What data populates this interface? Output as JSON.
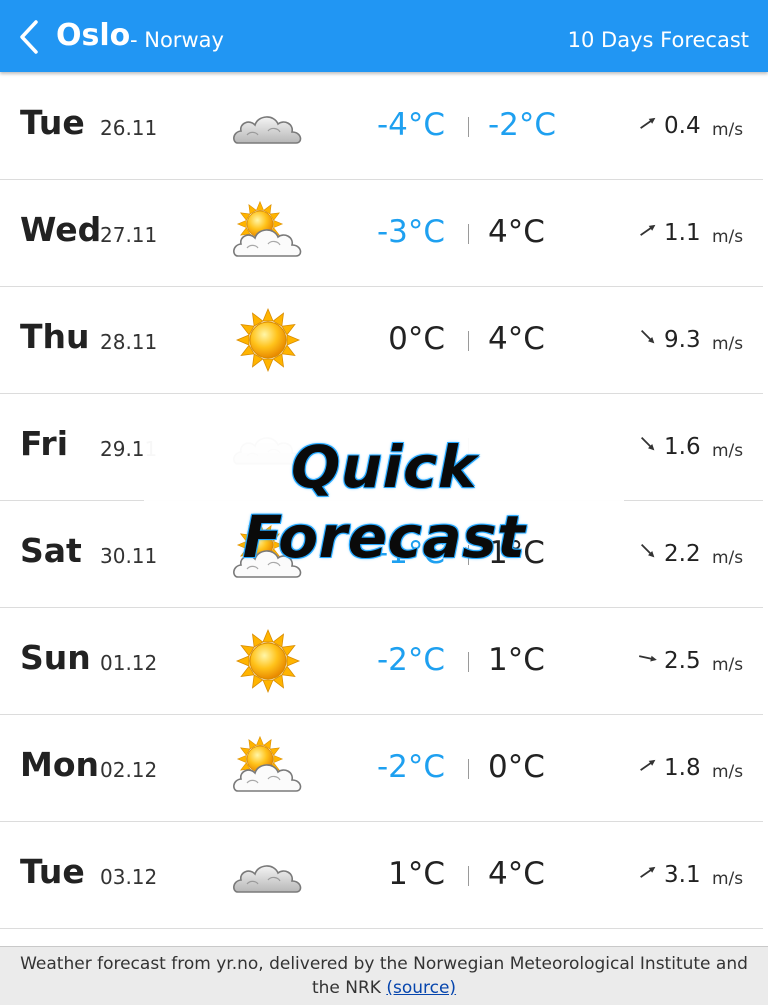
{
  "header": {
    "city": "Oslo",
    "country": "- Norway",
    "forecast_link": "10 Days Forecast"
  },
  "forecast": [
    {
      "day": "Tue",
      "date": "26.11",
      "icon": "cloud-icon",
      "min": "-4°C",
      "max": "-2°C",
      "min_neg": true,
      "max_neg": true,
      "wind_speed": "0.4",
      "wind_unit": "m/s",
      "wind_dir": "northeast"
    },
    {
      "day": "Wed",
      "date": "27.11",
      "icon": "partly-sunny-icon",
      "min": "-3°C",
      "max": "4°C",
      "min_neg": true,
      "max_neg": false,
      "wind_speed": "1.1",
      "wind_unit": "m/s",
      "wind_dir": "northeast"
    },
    {
      "day": "Thu",
      "date": "28.11",
      "icon": "sun-icon",
      "min": "0°C",
      "max": "4°C",
      "min_neg": false,
      "max_neg": false,
      "wind_speed": "9.3",
      "wind_unit": "m/s",
      "wind_dir": "southeast"
    },
    {
      "day": "Fri",
      "date": "29.11",
      "icon": "cloud-icon",
      "min": "",
      "max": "",
      "min_neg": false,
      "max_neg": false,
      "wind_speed": "1.6",
      "wind_unit": "m/s",
      "wind_dir": "southeast"
    },
    {
      "day": "Sat",
      "date": "30.11",
      "icon": "partly-sunny-icon",
      "min": "-1°C",
      "max": "1°C",
      "min_neg": true,
      "max_neg": false,
      "wind_speed": "2.2",
      "wind_unit": "m/s",
      "wind_dir": "southeast"
    },
    {
      "day": "Sun",
      "date": "01.12",
      "icon": "sun-icon",
      "min": "-2°C",
      "max": "1°C",
      "min_neg": true,
      "max_neg": false,
      "wind_speed": "2.5",
      "wind_unit": "m/s",
      "wind_dir": "east"
    },
    {
      "day": "Mon",
      "date": "02.12",
      "icon": "partly-sunny-icon",
      "min": "-2°C",
      "max": "0°C",
      "min_neg": true,
      "max_neg": false,
      "wind_speed": "1.8",
      "wind_unit": "m/s",
      "wind_dir": "northeast"
    },
    {
      "day": "Tue",
      "date": "03.12",
      "icon": "cloud-icon",
      "min": "1°C",
      "max": "4°C",
      "min_neg": false,
      "max_neg": false,
      "wind_speed": "3.1",
      "wind_unit": "m/s",
      "wind_dir": "northeast"
    }
  ],
  "overlay": {
    "title": "Quick Forecast"
  },
  "footer": {
    "text": "Weather forecast from yr.no, delivered by the Norwegian Meteorological Institute and the NRK",
    "source_link": "(source)"
  },
  "colors": {
    "header_bg": "#2196f3",
    "negative_temp": "#1ea0f0",
    "link": "#0645ad"
  }
}
